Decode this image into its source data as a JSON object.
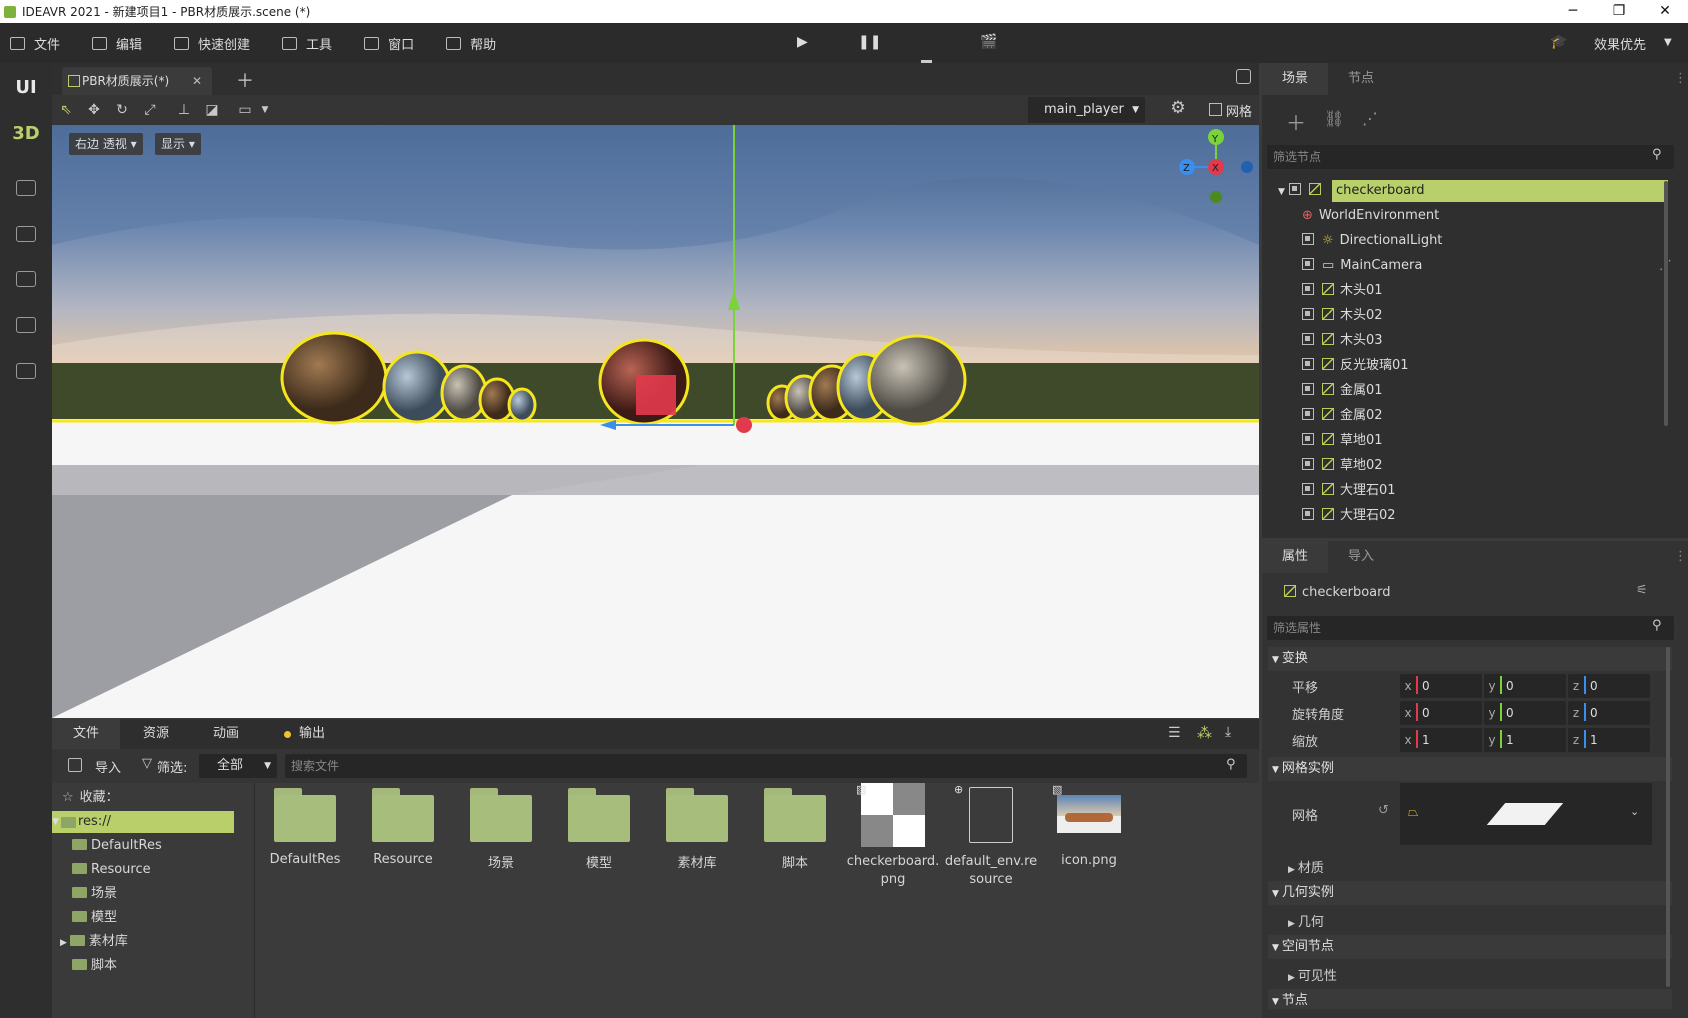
{
  "window": {
    "title": "IDEAVR 2021 - 新建项目1 - PBR材质展示.scene (*)",
    "controls": [
      "─",
      "❐",
      "✕"
    ]
  },
  "menu": {
    "items": [
      "文件",
      "编辑",
      "快速创建",
      "工具",
      "窗口",
      "帮助"
    ],
    "quality": "效果优先"
  },
  "leftStrip": {
    "ui": "UI",
    "d3": "3D"
  },
  "viewport": {
    "tab": "PBR材质展示(*)",
    "player": "main_player",
    "grid_label": "网格",
    "view_mode": "右边 透视",
    "display": "显示",
    "gizmo": {
      "y": "Y",
      "z": "Z",
      "x": "X"
    }
  },
  "bottom": {
    "tabs": [
      "文件",
      "资源",
      "动画",
      "输出"
    ],
    "import": "导入",
    "filter_label": "筛选:",
    "filter_value": "全部",
    "search_placeholder": "搜索文件",
    "favorites": "收藏：",
    "root": "res://",
    "tree": [
      "DefaultRes",
      "Resource",
      "场景",
      "模型",
      "素材库",
      "脚本"
    ],
    "files": [
      {
        "name": "DefaultRes",
        "kind": "folder"
      },
      {
        "name": "Resource",
        "kind": "folder"
      },
      {
        "name": "场景",
        "kind": "folder"
      },
      {
        "name": "模型",
        "kind": "folder"
      },
      {
        "name": "素材库",
        "kind": "folder"
      },
      {
        "name": "脚本",
        "kind": "folder"
      },
      {
        "name": "checkerboard.png",
        "kind": "image-checker"
      },
      {
        "name": "default_env.resource",
        "kind": "file"
      },
      {
        "name": "icon.png",
        "kind": "image-photo"
      }
    ]
  },
  "scene": {
    "tabs": [
      "场景",
      "节点"
    ],
    "filter_placeholder": "筛选节点",
    "root": "checkerboard",
    "nodes": [
      "WorldEnvironment",
      "DirectionalLight",
      "MainCamera",
      "木头01",
      "木头02",
      "木头03",
      "反光玻璃01",
      "金属01",
      "金属02",
      "草地01",
      "草地02",
      "大理石01",
      "大理石02"
    ]
  },
  "inspector": {
    "tabs": [
      "属性",
      "导入"
    ],
    "object": "checkerboard",
    "filter_placeholder": "筛选属性",
    "sections": {
      "transform": "变换",
      "mesh_instance": "网格实例",
      "material": "材质",
      "geometry_instance": "几何实例",
      "geometry": "几何",
      "spatial": "空间节点",
      "visibility": "可见性",
      "node": "节点"
    },
    "rows": {
      "translate": "平移",
      "rotation": "旋转角度",
      "scale": "缩放",
      "mesh": "网格"
    },
    "translate": [
      "0",
      "0",
      "0"
    ],
    "rotation": [
      "0",
      "0",
      "0"
    ],
    "scale": [
      "1",
      "1",
      "1"
    ],
    "axes": [
      "x",
      "y",
      "z"
    ]
  },
  "colors": {
    "accent": "#b8cf6a",
    "axis_x": "#e23a4d",
    "axis_y": "#7bd33b",
    "axis_z": "#3a8ef0",
    "select": "#f5e61e"
  }
}
